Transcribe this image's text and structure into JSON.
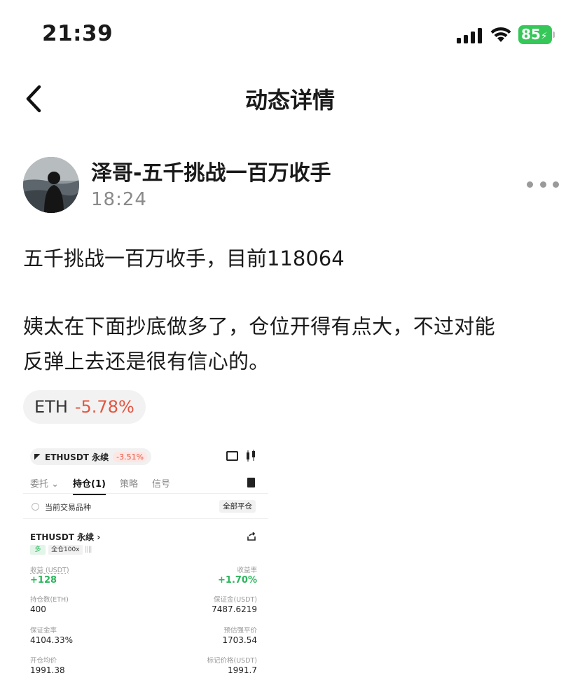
{
  "status_bar": {
    "time": "21:39",
    "battery": "85"
  },
  "nav": {
    "title": "动态详情"
  },
  "post": {
    "author": "泽哥-五千挑战一百万收手",
    "time": "18:24",
    "lines": [
      "五千挑战一百万收手，目前118064",
      "姨太在下面抄底做多了，仓位开得有点大，不过对能",
      "反弹上去还是很有信心的。"
    ],
    "ticker": {
      "symbol": "ETH",
      "change": "-5.78%"
    }
  },
  "embed": {
    "pair": "ETHUSDT 永续",
    "pair_change": "-3.51%",
    "tabs": [
      {
        "label": "委托 ⌄"
      },
      {
        "label": "持仓(1)"
      },
      {
        "label": "策略"
      },
      {
        "label": "信号"
      }
    ],
    "current_only_label": "当前交易品种",
    "close_all": "全部平仓",
    "position_title": "ETHUSDT 永续 ›",
    "long_badge": "多",
    "leverage_badge": "全仓100x",
    "fields": {
      "pnl_label": "收益 (USDT)",
      "pnl_value": "+128",
      "roi_label": "收益率",
      "roi_value": "+1.70%",
      "size_label": "持仓数(ETH)",
      "size_value": "400",
      "margin_label": "保证金(USDT)",
      "margin_value": "7487.6219",
      "margin_ratio_label": "保证金率",
      "margin_ratio_value": "4104.33%",
      "liq_label": "预估强平价",
      "liq_value": "1703.54",
      "entry_label": "开仓均价",
      "entry_value": "1991.38",
      "mark_label": "标记价格(USDT)",
      "mark_value": "1991.7"
    }
  }
}
